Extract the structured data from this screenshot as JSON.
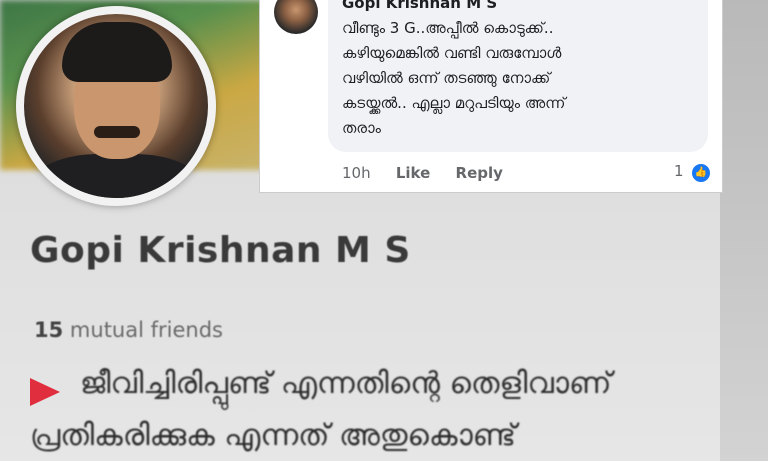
{
  "profile": {
    "name": "Gopi Krishnan M S",
    "mutual_count": "15",
    "mutual_label": "mutual friends",
    "bio_line_1": "ജീവിച്ചിരിപ്പുണ്ട് എന്നതിന്റെ തെളിവാണ്",
    "bio_line_2": "പ്രതികരിക്കുക എന്നത് അതുകൊണ്ട്"
  },
  "comment": {
    "author": "Gopi Krishnan M S",
    "text_lines": [
      "വീണ്ടും 3 G..അപ്പീൽ കൊടുക്ക്..",
      "കഴിയുമെങ്കിൽ വണ്ടി വരുമ്പോൾ",
      "വഴിയിൽ ഒന്ന് തടഞ്ഞു നോക്ക്",
      "കടയ്ക്കൽ.. എല്ലാ മറുപടിയും അന്ന്",
      "തരാം"
    ],
    "time": "10h",
    "like_label": "Like",
    "reply_label": "Reply",
    "reaction_count": "1",
    "reaction_icon": "like-icon",
    "colors": {
      "bubble": "#f0f2f5",
      "accent": "#1877f2",
      "bio_icon": "#e02e3e"
    }
  }
}
